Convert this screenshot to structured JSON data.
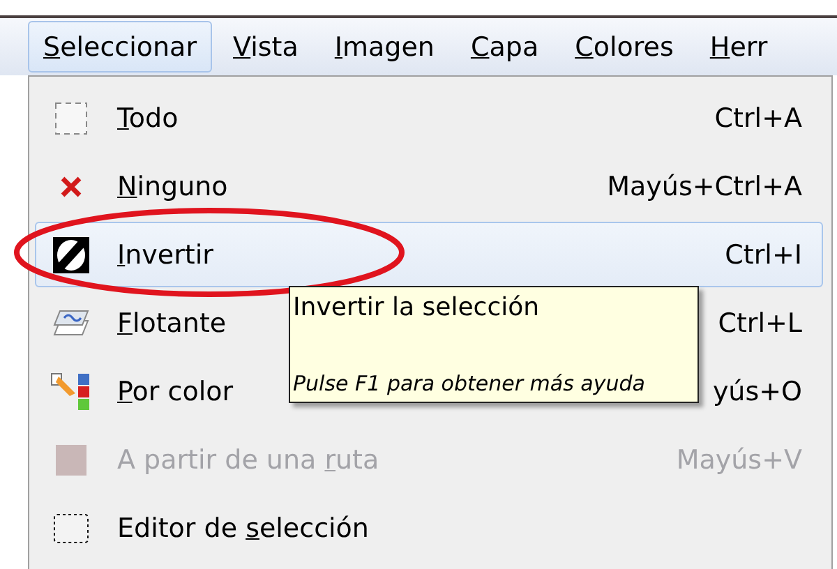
{
  "menubar": [
    {
      "label": {
        "key": "S",
        "after": "eleccionar"
      },
      "selected": true
    },
    {
      "label": {
        "key": "V",
        "after": "ista"
      },
      "selected": false
    },
    {
      "label": {
        "key": "I",
        "after": "magen"
      },
      "selected": false
    },
    {
      "label": {
        "key": "C",
        "after": "apa"
      },
      "selected": false
    },
    {
      "label": {
        "key": "C",
        "after": "olores"
      },
      "selected": false
    },
    {
      "label": {
        "key": "H",
        "after": "err"
      },
      "selected": false
    }
  ],
  "menu_items": [
    {
      "label": {
        "key": "T",
        "after": "odo"
      },
      "shortcut": "Ctrl+A",
      "selected": false,
      "disabled": false
    },
    {
      "label": {
        "key": "N",
        "after": "inguno"
      },
      "shortcut": "Mayús+Ctrl+A",
      "selected": false,
      "disabled": false
    },
    {
      "label": {
        "key": "I",
        "after": "nvertir"
      },
      "shortcut": "Ctrl+I",
      "selected": true,
      "disabled": false
    },
    {
      "label": {
        "key": "F",
        "after": "lotante"
      },
      "shortcut": "Ctrl+L",
      "selected": false,
      "disabled": false
    },
    {
      "label": {
        "key": "P",
        "after": "or color"
      },
      "shortcut": "yús+O",
      "selected": false,
      "disabled": false
    },
    {
      "label": {
        "before": "A partir de una ",
        "key": "r",
        "after": "uta"
      },
      "shortcut": "Mayús+V",
      "selected": false,
      "disabled": true
    },
    {
      "label": {
        "before": "Editor de ",
        "key": "s",
        "after": "elección"
      },
      "selected": false,
      "disabled": false
    }
  ],
  "tooltip": {
    "title": "Invertir la selección",
    "hint": "Pulse F1 para obtener más ayuda"
  }
}
